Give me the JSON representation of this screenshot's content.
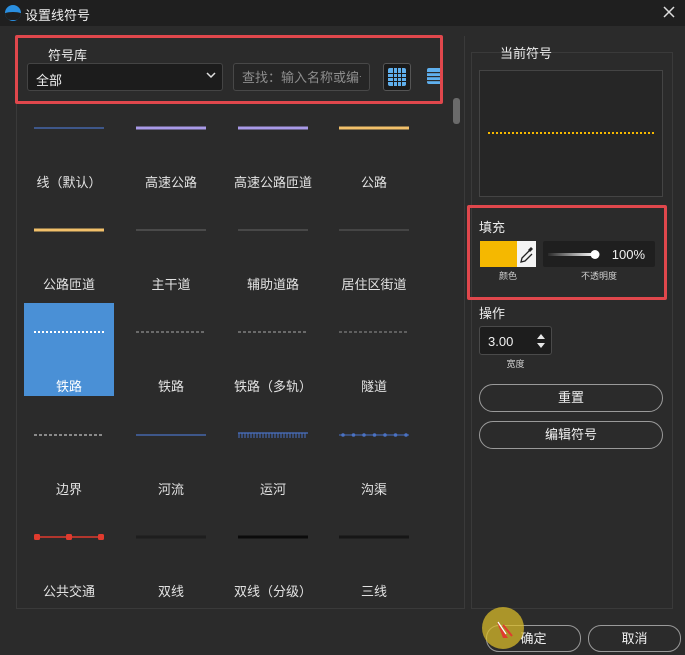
{
  "window": {
    "title": "设置线符号",
    "close_icon": "close-icon"
  },
  "library": {
    "title": "符号库",
    "category": {
      "selected": "全部"
    },
    "search": {
      "placeholder": "查找：输入名称或编号",
      "value": ""
    },
    "view_modes": [
      "grid-view-icon",
      "list-view-icon"
    ]
  },
  "symbols": [
    {
      "label": "线（默认）",
      "style": "thin",
      "color": "#4a72c4"
    },
    {
      "label": "高速公路",
      "style": "thick",
      "color": "#a99ae8"
    },
    {
      "label": "高速公路匝道",
      "style": "thick",
      "color": "#a99ae8"
    },
    {
      "label": "公路",
      "style": "thick",
      "color": "#f2c06a"
    },
    {
      "label": "公路匝道",
      "style": "thick",
      "color": "#f2c06a"
    },
    {
      "label": "主干道",
      "style": "thin",
      "color": "#5c5c5c"
    },
    {
      "label": "辅助道路",
      "style": "thin",
      "color": "#5a5a5a"
    },
    {
      "label": "居住区街道",
      "style": "thin",
      "color": "#555555"
    },
    {
      "label": "铁路",
      "style": "rail",
      "color": "#ffffff",
      "selected": true
    },
    {
      "label": "铁路",
      "style": "dash",
      "color": "#6a6a6a"
    },
    {
      "label": "铁路（多轨）",
      "style": "dash",
      "color": "#6a6a6a"
    },
    {
      "label": "隧道",
      "style": "dash",
      "color": "#5f5f5f"
    },
    {
      "label": "边界",
      "style": "dash",
      "color": "#8a8a8a"
    },
    {
      "label": "河流",
      "style": "thin",
      "color": "#4a72c4"
    },
    {
      "label": "运河",
      "style": "ticks",
      "color": "#4a72c4"
    },
    {
      "label": "沟渠",
      "style": "dots",
      "color": "#4a72c4"
    },
    {
      "label": "公共交通",
      "style": "transit",
      "color": "#e03b2e"
    },
    {
      "label": "双线",
      "style": "thick",
      "color": "#1e1e1e"
    },
    {
      "label": "双线（分级）",
      "style": "thick",
      "color": "#0b0b0b"
    },
    {
      "label": "三线",
      "style": "thick",
      "color": "#161616"
    }
  ],
  "current": {
    "title": "当前符号",
    "preview_color": "#f5b800",
    "fill": {
      "title": "填充",
      "color": "#f5b800",
      "color_label": "颜色",
      "opacity": "100%",
      "opacity_value": 1.0,
      "opacity_label": "不透明度"
    },
    "operation": {
      "title": "操作",
      "width": "3.00",
      "width_label": "宽度"
    },
    "reset_label": "重置",
    "edit_label": "编辑符号"
  },
  "footer": {
    "ok_label": "确定",
    "cancel_label": "取消"
  },
  "highlight_color": "#e0474c",
  "selection_color": "#4a90d6"
}
